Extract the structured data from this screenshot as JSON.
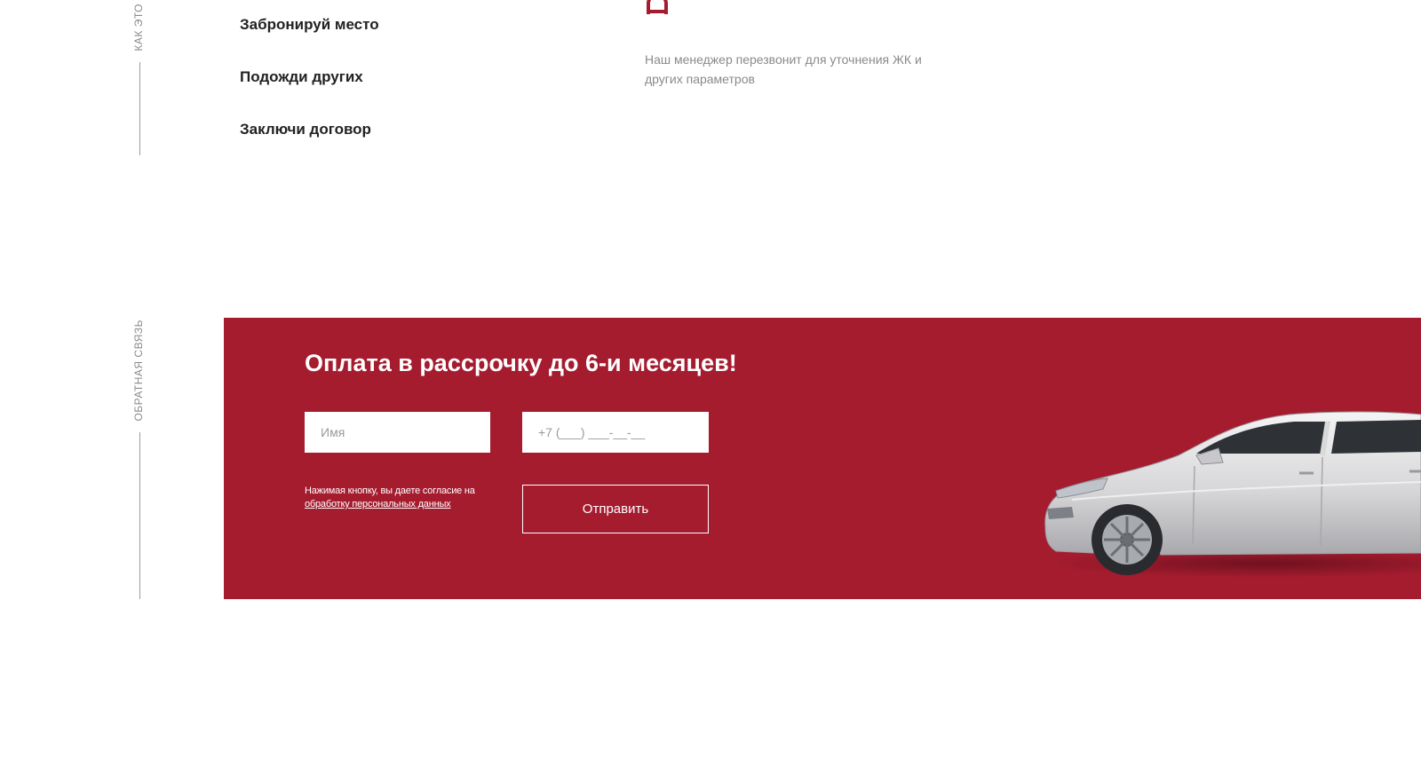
{
  "side_labels": {
    "how_it_works": "КАК ЭТО",
    "feedback": "ОБРАТНАЯ СВЯЗЬ"
  },
  "steps": [
    {
      "label": "Забронируй место"
    },
    {
      "label": "Подожди других"
    },
    {
      "label": "Заключи договор"
    }
  ],
  "step_detail": {
    "icon": "step-icon",
    "description": "Наш менеджер перезвонит для уточнения ЖК и других параметров"
  },
  "promo": {
    "title": "Оплата в рассрочку до 6-и месяцев!",
    "name_placeholder": "Имя",
    "phone_placeholder": "+7 (___) ___-__-__",
    "consent_text": "Нажимая кнопку, вы даете согласие на",
    "consent_link": "обработку персональных данных",
    "submit_label": "Отправить",
    "image": "car-image"
  },
  "colors": {
    "accent": "#a51c2f",
    "heading": "#222222",
    "muted": "#8a8a8a"
  }
}
